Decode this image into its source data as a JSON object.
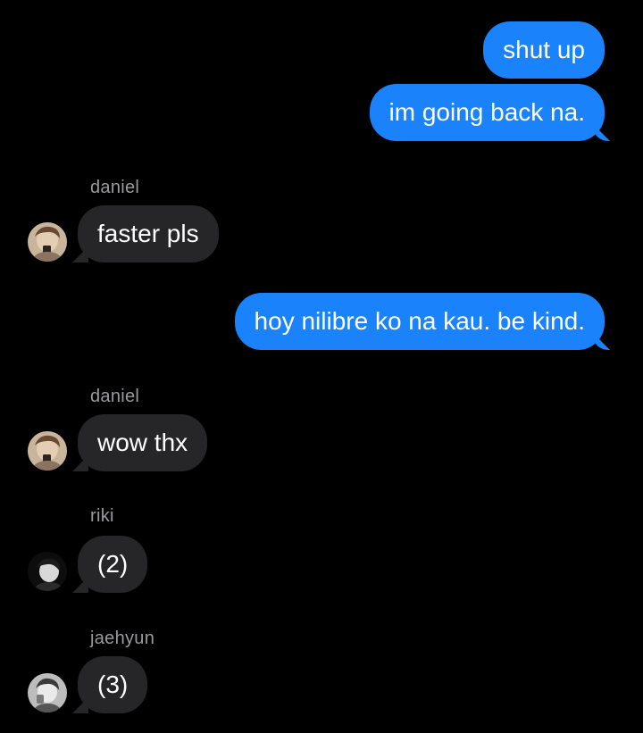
{
  "messages": [
    {
      "id": "m1",
      "direction": "outgoing",
      "text": "shut up"
    },
    {
      "id": "m2",
      "direction": "outgoing",
      "text": "im going back na."
    },
    {
      "id": "m3",
      "direction": "incoming",
      "sender": "daniel",
      "text": "faster pls"
    },
    {
      "id": "m4",
      "direction": "outgoing",
      "text": "hoy nilibre ko na kau. be kind."
    },
    {
      "id": "m5",
      "direction": "incoming",
      "sender": "daniel",
      "text": "wow thx"
    },
    {
      "id": "m6",
      "direction": "incoming",
      "sender": "riki",
      "text": "(2)"
    },
    {
      "id": "m7",
      "direction": "incoming",
      "sender": "jaehyun",
      "text": "(3)"
    }
  ],
  "colors": {
    "outgoing_bubble": "#1a82fb",
    "incoming_bubble": "#262628",
    "sender_label": "#9a9a9f",
    "background": "#000000"
  },
  "icons": {
    "daniel_avatar": "profile-photo",
    "riki_avatar": "profile-photo",
    "jaehyun_avatar": "profile-photo"
  }
}
